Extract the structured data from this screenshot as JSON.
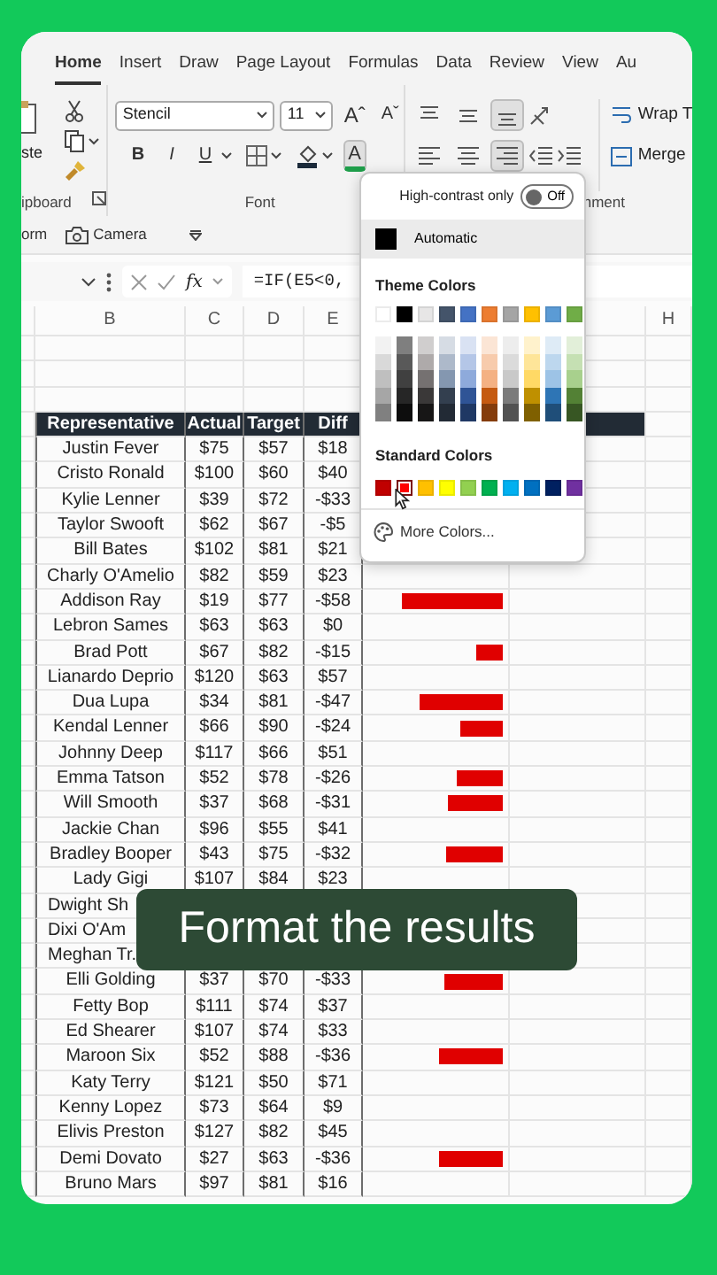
{
  "tabs": [
    {
      "label": "Home",
      "selected": true
    },
    {
      "label": "Insert",
      "selected": false
    },
    {
      "label": "Draw",
      "selected": false
    },
    {
      "label": "Page Layout",
      "selected": false
    },
    {
      "label": "Formulas",
      "selected": false
    },
    {
      "label": "Data",
      "selected": false
    },
    {
      "label": "Review",
      "selected": false
    },
    {
      "label": "View",
      "selected": false
    },
    {
      "label": "Au",
      "selected": false
    }
  ],
  "ribbon": {
    "clipboard": {
      "paste_label": "ste",
      "group_label": "ipboard"
    },
    "font": {
      "font_name": "Stencil",
      "font_size": "11",
      "grow": "Aˆ",
      "shrink": "Aˇ",
      "bold": "B",
      "italic": "I",
      "underline": "U",
      "font_color": {
        "label": "A",
        "pressed": true
      },
      "group_label": "Font"
    },
    "alignment": {
      "vertical_align": [
        {
          "pressed": false
        },
        {
          "pressed": false
        },
        {
          "pressed": true
        }
      ],
      "horizontal_align": [
        {
          "pressed": false
        },
        {
          "pressed": false
        },
        {
          "pressed": true
        }
      ],
      "wrap": "Wrap T",
      "merge": "Merge",
      "group_label": "nment"
    }
  },
  "quick_access": {
    "form": "orm",
    "camera": "Camera"
  },
  "formula_bar": {
    "function_label": "fx",
    "formula": "=IF(E5<0,"
  },
  "column_headers": [
    "B",
    "C",
    "D",
    "E",
    "H"
  ],
  "table": {
    "columns": [
      "Representative",
      "Actual",
      "Target",
      "Diff"
    ],
    "rows": [
      {
        "name": "Justin Fever",
        "actual": "$75",
        "target": "$57",
        "diff": "$18"
      },
      {
        "name": "Cristo Ronald",
        "actual": "$100",
        "target": "$60",
        "diff": "$40"
      },
      {
        "name": "Kylie Lenner",
        "actual": "$39",
        "target": "$72",
        "diff": "-$33"
      },
      {
        "name": "Taylor Swooft",
        "actual": "$62",
        "target": "$67",
        "diff": "-$5"
      },
      {
        "name": "Bill Bates",
        "actual": "$102",
        "target": "$81",
        "diff": "$21"
      },
      {
        "name": "Charly O'Amelio",
        "actual": "$82",
        "target": "$59",
        "diff": "$23"
      },
      {
        "name": "Addison Ray",
        "actual": "$19",
        "target": "$77",
        "diff": "-$58",
        "level": 0.71
      },
      {
        "name": "Lebron Sames",
        "actual": "$63",
        "target": "$63",
        "diff": "$0"
      },
      {
        "name": "Brad Pott",
        "actual": "$67",
        "target": "$82",
        "diff": "-$15",
        "level": 0.19
      },
      {
        "name": "Lianardo Deprio",
        "actual": "$120",
        "target": "$63",
        "diff": "$57"
      },
      {
        "name": "Dua Lupa",
        "actual": "$34",
        "target": "$81",
        "diff": "-$47",
        "level": 0.59
      },
      {
        "name": "Kendal Lenner",
        "actual": "$66",
        "target": "$90",
        "diff": "-$24",
        "level": 0.3
      },
      {
        "name": "Johnny Deep",
        "actual": "$117",
        "target": "$66",
        "diff": "$51"
      },
      {
        "name": "Emma Tatson",
        "actual": "$52",
        "target": "$78",
        "diff": "-$26",
        "level": 0.33
      },
      {
        "name": "Will Smooth",
        "actual": "$37",
        "target": "$68",
        "diff": "-$31",
        "level": 0.39
      },
      {
        "name": "Jackie Chan",
        "actual": "$96",
        "target": "$55",
        "diff": "$41"
      },
      {
        "name": "Bradley Booper",
        "actual": "$43",
        "target": "$75",
        "diff": "-$32",
        "level": 0.4
      },
      {
        "name": "Lady Gigi",
        "actual": "$107",
        "target": "$84",
        "diff": "$23"
      },
      {
        "name": "Dwight Sh"
      },
      {
        "name": "Dixi O'Am"
      },
      {
        "name": "Meghan Tr."
      },
      {
        "name": "Elli Golding",
        "actual": "$37",
        "target": "$70",
        "diff": "-$33",
        "level": 0.41
      },
      {
        "name": "Fetty Bop",
        "actual": "$111",
        "target": "$74",
        "diff": "$37"
      },
      {
        "name": "Ed Shearer",
        "actual": "$107",
        "target": "$74",
        "diff": "$33"
      },
      {
        "name": "Maroon Six",
        "actual": "$52",
        "target": "$88",
        "diff": "-$36",
        "level": 0.45
      },
      {
        "name": "Katy Terry",
        "actual": "$121",
        "target": "$50",
        "diff": "$71"
      },
      {
        "name": "Kenny Lopez",
        "actual": "$73",
        "target": "$64",
        "diff": "$9"
      },
      {
        "name": "Elivis Preston",
        "actual": "$127",
        "target": "$82",
        "diff": "$45"
      },
      {
        "name": "Demi Dovato",
        "actual": "$27",
        "target": "$63",
        "diff": "-$36",
        "level": 0.45
      },
      {
        "name": "Bruno Mars",
        "actual": "$97",
        "target": "$81",
        "diff": "$16"
      }
    ]
  },
  "color_picker": {
    "high_contrast_label": "High-contrast only",
    "high_contrast": {
      "on": false,
      "label": "Off"
    },
    "automatic": {
      "label": "Automatic",
      "color": "#000000",
      "highlighted": true
    },
    "theme_title": "Theme Colors",
    "theme_colors": [
      {
        "color": "#ffffff",
        "shades": [
          {
            "color": "#f2f2f2"
          },
          {
            "color": "#d9d9d9"
          },
          {
            "color": "#bfbfbf"
          },
          {
            "color": "#a6a6a6"
          },
          {
            "color": "#808080"
          }
        ]
      },
      {
        "color": "#000000",
        "shades": [
          {
            "color": "#7f7f7f"
          },
          {
            "color": "#595959"
          },
          {
            "color": "#404040"
          },
          {
            "color": "#262626"
          },
          {
            "color": "#0d0d0d"
          }
        ]
      },
      {
        "color": "#e7e6e6",
        "shades": [
          {
            "color": "#d0cece"
          },
          {
            "color": "#aeaaaa"
          },
          {
            "color": "#757171"
          },
          {
            "color": "#3a3838"
          },
          {
            "color": "#171616"
          }
        ]
      },
      {
        "color": "#44546a",
        "shades": [
          {
            "color": "#d6dce4"
          },
          {
            "color": "#adb9ca"
          },
          {
            "color": "#8497b0"
          },
          {
            "color": "#333f4f"
          },
          {
            "color": "#222a35"
          }
        ]
      },
      {
        "color": "#4472c4",
        "shades": [
          {
            "color": "#d9e2f3"
          },
          {
            "color": "#b4c6e7"
          },
          {
            "color": "#8eaadb"
          },
          {
            "color": "#2f5496"
          },
          {
            "color": "#1f3864"
          }
        ]
      },
      {
        "color": "#ed7d31",
        "shades": [
          {
            "color": "#fbe5d5"
          },
          {
            "color": "#f7cbac"
          },
          {
            "color": "#f4b183"
          },
          {
            "color": "#c55a11"
          },
          {
            "color": "#843c0b"
          }
        ]
      },
      {
        "color": "#a5a5a5",
        "shades": [
          {
            "color": "#ededed"
          },
          {
            "color": "#dbdbdb"
          },
          {
            "color": "#c9c9c9"
          },
          {
            "color": "#7b7b7b"
          },
          {
            "color": "#525252"
          }
        ]
      },
      {
        "color": "#ffc000",
        "shades": [
          {
            "color": "#fff2cc"
          },
          {
            "color": "#fee599"
          },
          {
            "color": "#ffd965"
          },
          {
            "color": "#bf9000"
          },
          {
            "color": "#7f6000"
          }
        ]
      },
      {
        "color": "#5b9bd5",
        "shades": [
          {
            "color": "#deebf6"
          },
          {
            "color": "#bdd7ee"
          },
          {
            "color": "#9dc3e6"
          },
          {
            "color": "#2e75b5"
          },
          {
            "color": "#1f4e79"
          }
        ]
      },
      {
        "color": "#70ad47",
        "shades": [
          {
            "color": "#e2efd9"
          },
          {
            "color": "#c5e0b3"
          },
          {
            "color": "#a8d08d"
          },
          {
            "color": "#538135"
          },
          {
            "color": "#375623"
          }
        ]
      }
    ],
    "standard_title": "Standard Colors",
    "standard_colors": [
      {
        "color": "#c00000",
        "selected": false
      },
      {
        "color": "#ff0000",
        "selected": true
      },
      {
        "color": "#ffc000",
        "selected": false
      },
      {
        "color": "#ffff00",
        "selected": false
      },
      {
        "color": "#92d050",
        "selected": false
      },
      {
        "color": "#00b050",
        "selected": false
      },
      {
        "color": "#00b0f0",
        "selected": false
      },
      {
        "color": "#0070c0",
        "selected": false
      },
      {
        "color": "#002060",
        "selected": false
      },
      {
        "color": "#7030a0",
        "selected": false
      }
    ],
    "more_colors": "More Colors..."
  },
  "caption": "Format the results"
}
